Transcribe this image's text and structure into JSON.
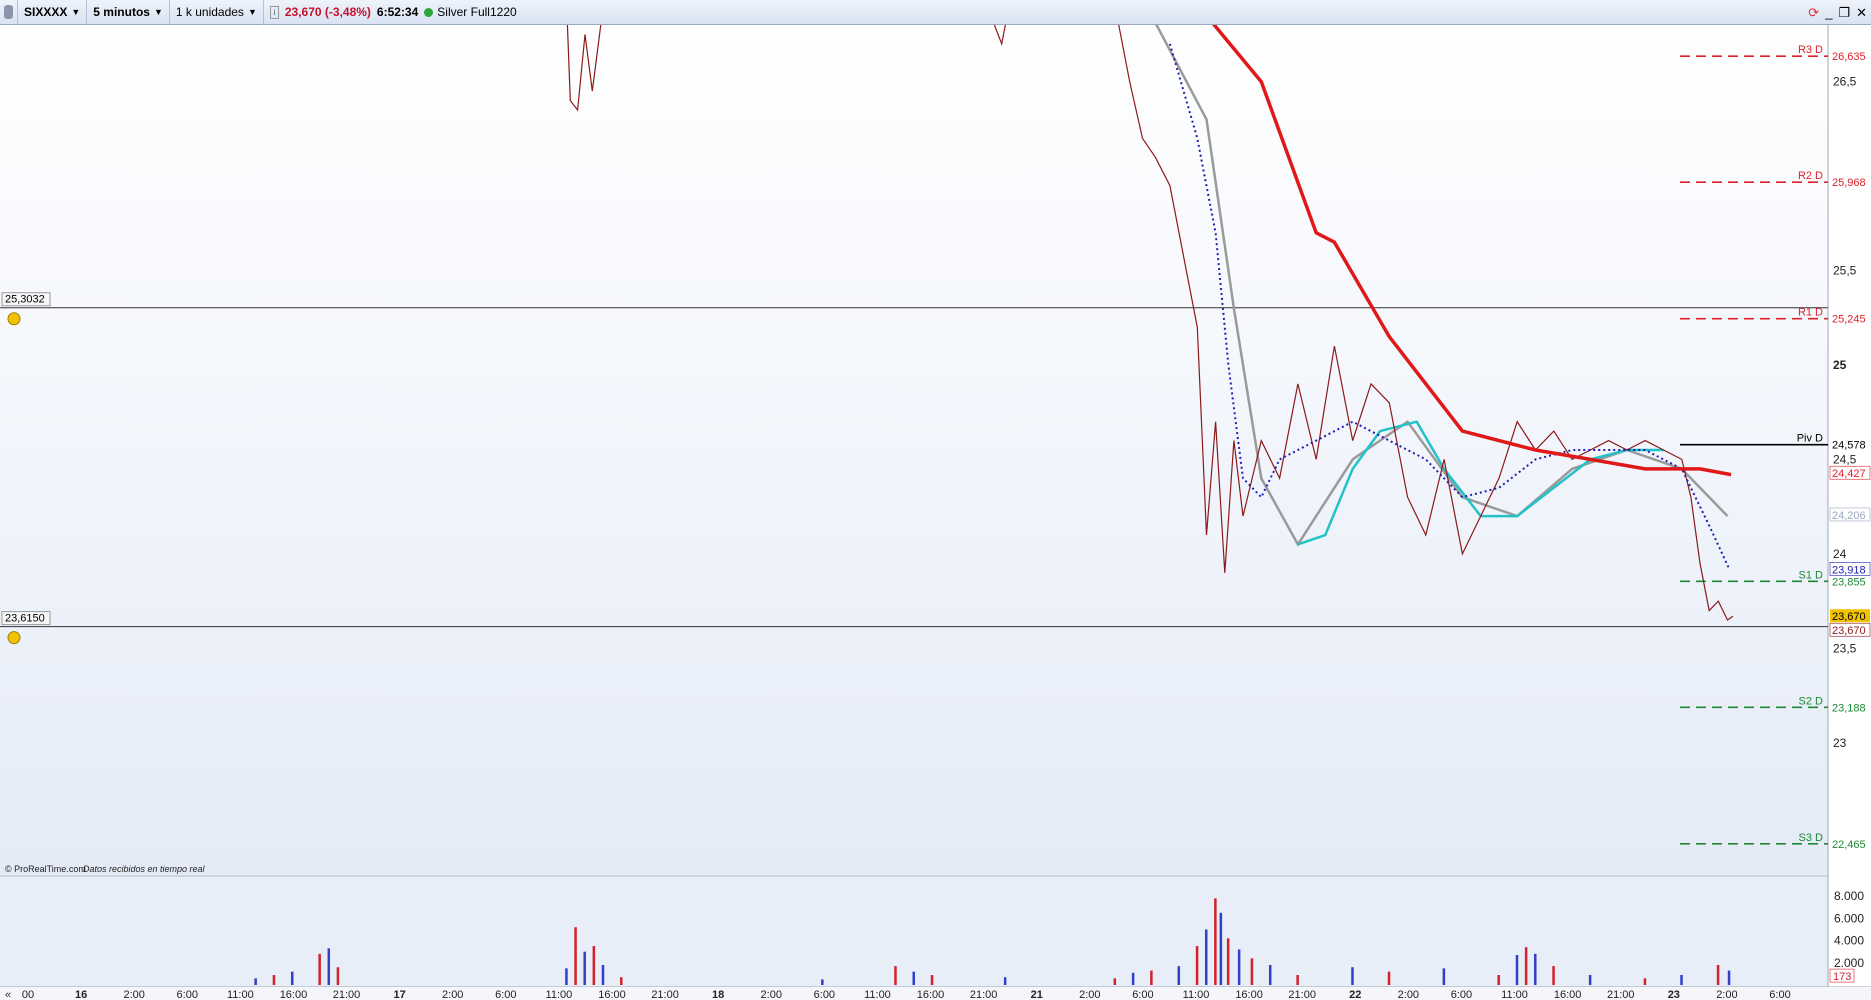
{
  "toolbar": {
    "instrument": "SIXXXX",
    "timeframe": "5 minutos",
    "units": "1 k unidades",
    "info_icon": "info-icon",
    "price": "23,670 (-3,48%)",
    "time": "6:52:34",
    "status_color": "#2aa53c",
    "contract": "Silver Full1220"
  },
  "footer": {
    "copyright": "© ProRealTime.com",
    "realtime": "Datos recibidos en tiempo real",
    "scroll_left": "«"
  },
  "colors": {
    "resistance": "#e0202a",
    "support": "#1d8a33",
    "pivot": "#000000",
    "ma_red": "#e01818",
    "ma_grey": "#9a9a9a",
    "ma_cyan": "#22c3c8",
    "ma_dotted": "#2020b0",
    "price_line": "#8b1a1a",
    "current_price_bg": "#f2c200"
  },
  "chart_data": {
    "type": "line",
    "price_axis": {
      "range": [
        22.3,
        26.8
      ],
      "ticks": [
        "26,5",
        "25,5",
        "25",
        "24,5",
        "24",
        "23,5",
        "23"
      ],
      "tick_values": [
        26.5,
        25.5,
        25.0,
        24.5,
        24.0,
        23.5,
        23.0
      ]
    },
    "x_axis": {
      "tick_labels": [
        "00",
        "16",
        "2:00",
        "6:00",
        "11:00",
        "16:00",
        "21:00",
        "17",
        "2:00",
        "6:00",
        "11:00",
        "16:00",
        "21:00",
        "18",
        "2:00",
        "6:00",
        "11:00",
        "16:00",
        "21:00",
        "21",
        "2:00",
        "6:00",
        "11:00",
        "16:00",
        "21:00",
        "22",
        "2:00",
        "6:00",
        "11:00",
        "16:00",
        "21:00",
        "23",
        "2:00",
        "6:00"
      ],
      "day_labels": [
        "16",
        "17",
        "18",
        "21",
        "22",
        "23"
      ]
    },
    "horizontal_lines": [
      {
        "label": "25,3032",
        "value": 25.3032
      },
      {
        "label": "23,6150",
        "value": 23.615
      }
    ],
    "pivot_levels": [
      {
        "name": "R3 D",
        "label": "26,635",
        "value": 26.635,
        "kind": "resistance"
      },
      {
        "name": "R2 D",
        "label": "25,968",
        "value": 25.968,
        "kind": "resistance"
      },
      {
        "name": "R1 D",
        "label": "25,245",
        "value": 25.245,
        "kind": "resistance"
      },
      {
        "name": "Piv D",
        "label": "24,578",
        "value": 24.578,
        "kind": "pivot"
      },
      {
        "name": "S1 D",
        "label": "23,855",
        "value": 23.855,
        "kind": "support"
      },
      {
        "name": "S2 D",
        "label": "23,188",
        "value": 23.188,
        "kind": "support"
      },
      {
        "name": "S3 D",
        "label": "22,465",
        "value": 22.465,
        "kind": "support"
      }
    ],
    "right_labels": [
      {
        "label": "24,427",
        "value": 24.427,
        "color": "#e0202a"
      },
      {
        "label": "24,206",
        "value": 24.206,
        "color": "#9aa9c2"
      },
      {
        "label": "23,918",
        "value": 23.918,
        "color": "#2020b0"
      },
      {
        "label": "23,670",
        "value": 23.67,
        "color": "#000000",
        "highlight": true
      },
      {
        "label": "23,670",
        "value": 23.67,
        "color": "#8b1a1a"
      }
    ],
    "price_series": {
      "name": "",
      "points": [
        [
          0.31,
          26.9
        ],
        [
          0.312,
          26.4
        ],
        [
          0.316,
          26.35
        ],
        [
          0.32,
          26.75
        ],
        [
          0.324,
          26.45
        ],
        [
          0.33,
          26.9
        ],
        [
          0.54,
          26.9
        ],
        [
          0.548,
          26.7
        ],
        [
          0.552,
          26.9
        ],
        [
          0.61,
          26.9
        ],
        [
          0.618,
          26.5
        ],
        [
          0.625,
          26.2
        ],
        [
          0.632,
          26.1
        ],
        [
          0.64,
          25.95
        ],
        [
          0.648,
          25.55
        ],
        [
          0.655,
          25.2
        ],
        [
          0.66,
          24.1
        ],
        [
          0.665,
          24.7
        ],
        [
          0.67,
          23.9
        ],
        [
          0.675,
          24.6
        ],
        [
          0.68,
          24.2
        ],
        [
          0.69,
          24.6
        ],
        [
          0.7,
          24.4
        ],
        [
          0.71,
          24.9
        ],
        [
          0.72,
          24.5
        ],
        [
          0.73,
          25.1
        ],
        [
          0.74,
          24.6
        ],
        [
          0.75,
          24.9
        ],
        [
          0.76,
          24.8
        ],
        [
          0.77,
          24.3
        ],
        [
          0.78,
          24.1
        ],
        [
          0.79,
          24.5
        ],
        [
          0.8,
          24.0
        ],
        [
          0.81,
          24.2
        ],
        [
          0.82,
          24.4
        ],
        [
          0.83,
          24.7
        ],
        [
          0.84,
          24.55
        ],
        [
          0.85,
          24.65
        ],
        [
          0.86,
          24.5
        ],
        [
          0.87,
          24.55
        ],
        [
          0.88,
          24.6
        ],
        [
          0.89,
          24.55
        ],
        [
          0.9,
          24.6
        ],
        [
          0.91,
          24.55
        ],
        [
          0.92,
          24.5
        ],
        [
          0.925,
          24.3
        ],
        [
          0.93,
          23.95
        ],
        [
          0.935,
          23.7
        ],
        [
          0.94,
          23.75
        ],
        [
          0.945,
          23.65
        ],
        [
          0.948,
          23.67
        ]
      ]
    },
    "ma_red": {
      "name": "",
      "points": [
        [
          0.66,
          26.85
        ],
        [
          0.69,
          26.5
        ],
        [
          0.72,
          25.7
        ],
        [
          0.73,
          25.65
        ],
        [
          0.76,
          25.15
        ],
        [
          0.8,
          24.65
        ],
        [
          0.84,
          24.55
        ],
        [
          0.87,
          24.5
        ],
        [
          0.9,
          24.45
        ],
        [
          0.93,
          24.45
        ],
        [
          0.947,
          24.42
        ]
      ]
    },
    "ma_grey": {
      "name": "",
      "points": [
        [
          0.63,
          26.85
        ],
        [
          0.66,
          26.3
        ],
        [
          0.675,
          25.3
        ],
        [
          0.69,
          24.4
        ],
        [
          0.71,
          24.05
        ],
        [
          0.74,
          24.5
        ],
        [
          0.77,
          24.7
        ],
        [
          0.8,
          24.3
        ],
        [
          0.83,
          24.2
        ],
        [
          0.86,
          24.45
        ],
        [
          0.89,
          24.55
        ],
        [
          0.92,
          24.45
        ],
        [
          0.945,
          24.2
        ]
      ]
    },
    "ma_cyan": {
      "name": "",
      "points": [
        [
          0.71,
          24.05
        ],
        [
          0.725,
          24.1
        ],
        [
          0.74,
          24.45
        ],
        [
          0.755,
          24.65
        ],
        [
          0.775,
          24.7
        ],
        [
          0.79,
          24.45
        ],
        [
          0.81,
          24.2
        ],
        [
          0.83,
          24.2
        ],
        [
          0.85,
          24.35
        ],
        [
          0.87,
          24.5
        ],
        [
          0.89,
          24.55
        ],
        [
          0.91,
          24.55
        ]
      ]
    },
    "ma_dotted": {
      "name": "",
      "points": [
        [
          0.64,
          26.7
        ],
        [
          0.655,
          26.2
        ],
        [
          0.665,
          25.7
        ],
        [
          0.672,
          25.0
        ],
        [
          0.68,
          24.4
        ],
        [
          0.69,
          24.3
        ],
        [
          0.7,
          24.5
        ],
        [
          0.72,
          24.6
        ],
        [
          0.74,
          24.7
        ],
        [
          0.76,
          24.6
        ],
        [
          0.78,
          24.5
        ],
        [
          0.8,
          24.3
        ],
        [
          0.82,
          24.35
        ],
        [
          0.84,
          24.5
        ],
        [
          0.86,
          24.55
        ],
        [
          0.88,
          24.55
        ],
        [
          0.9,
          24.55
        ],
        [
          0.92,
          24.45
        ],
        [
          0.935,
          24.15
        ],
        [
          0.946,
          23.92
        ]
      ]
    },
    "volume": {
      "axis_ticks": [
        "8.000",
        "6.000",
        "4.000",
        "2.000"
      ],
      "tick_values": [
        8000,
        6000,
        4000,
        2000
      ],
      "range": [
        0,
        9000
      ],
      "last_label": "173",
      "last_value": 173,
      "bars": [
        {
          "x": 0.14,
          "v": 600
        },
        {
          "x": 0.15,
          "v": 900
        },
        {
          "x": 0.16,
          "v": 1200
        },
        {
          "x": 0.175,
          "v": 2800
        },
        {
          "x": 0.18,
          "v": 3300
        },
        {
          "x": 0.185,
          "v": 1600
        },
        {
          "x": 0.31,
          "v": 1500
        },
        {
          "x": 0.315,
          "v": 5200
        },
        {
          "x": 0.32,
          "v": 3000
        },
        {
          "x": 0.325,
          "v": 3500
        },
        {
          "x": 0.33,
          "v": 1800
        },
        {
          "x": 0.34,
          "v": 700
        },
        {
          "x": 0.45,
          "v": 500
        },
        {
          "x": 0.49,
          "v": 1700
        },
        {
          "x": 0.5,
          "v": 1200
        },
        {
          "x": 0.51,
          "v": 900
        },
        {
          "x": 0.55,
          "v": 700
        },
        {
          "x": 0.61,
          "v": 600
        },
        {
          "x": 0.62,
          "v": 1100
        },
        {
          "x": 0.63,
          "v": 1300
        },
        {
          "x": 0.645,
          "v": 1700
        },
        {
          "x": 0.655,
          "v": 3500
        },
        {
          "x": 0.66,
          "v": 5000
        },
        {
          "x": 0.665,
          "v": 7800
        },
        {
          "x": 0.668,
          "v": 6500
        },
        {
          "x": 0.672,
          "v": 4200
        },
        {
          "x": 0.678,
          "v": 3200
        },
        {
          "x": 0.685,
          "v": 2400
        },
        {
          "x": 0.695,
          "v": 1800
        },
        {
          "x": 0.71,
          "v": 900
        },
        {
          "x": 0.74,
          "v": 1600
        },
        {
          "x": 0.76,
          "v": 1200
        },
        {
          "x": 0.79,
          "v": 1500
        },
        {
          "x": 0.82,
          "v": 900
        },
        {
          "x": 0.83,
          "v": 2700
        },
        {
          "x": 0.835,
          "v": 3400
        },
        {
          "x": 0.84,
          "v": 2800
        },
        {
          "x": 0.85,
          "v": 1700
        },
        {
          "x": 0.87,
          "v": 900
        },
        {
          "x": 0.9,
          "v": 600
        },
        {
          "x": 0.92,
          "v": 900
        },
        {
          "x": 0.94,
          "v": 1800
        },
        {
          "x": 0.946,
          "v": 1300
        }
      ]
    }
  }
}
